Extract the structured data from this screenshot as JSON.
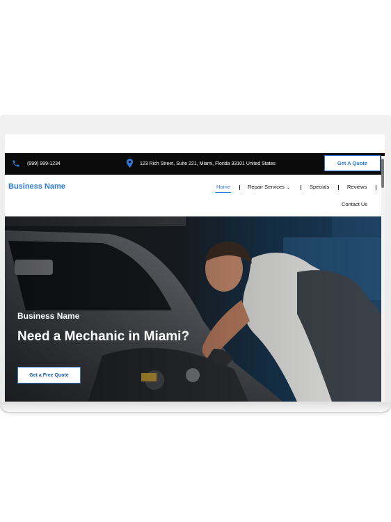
{
  "topbar": {
    "phone": "(999) 999-1234",
    "address": "123 Rich Street, Suite 221, Miami, Florida 33101 United States",
    "quote_button": "Get A Quote"
  },
  "header": {
    "brand": "Business Name",
    "nav": {
      "home": "Home",
      "repair_services": "Repair Services",
      "specials": "Specials",
      "reviews": "Reviews",
      "contact": "Contact Us"
    }
  },
  "hero": {
    "subtitle": "Business Name",
    "title": "Need a Mechanic in Miami?",
    "cta": "Get a Free Quote"
  },
  "colors": {
    "accent": "#2f7ad9",
    "topbar_bg": "#0b0b0b"
  },
  "icons": {
    "phone": "phone-icon",
    "location": "map-pin-icon",
    "dropdown": "chevron-down-icon"
  }
}
